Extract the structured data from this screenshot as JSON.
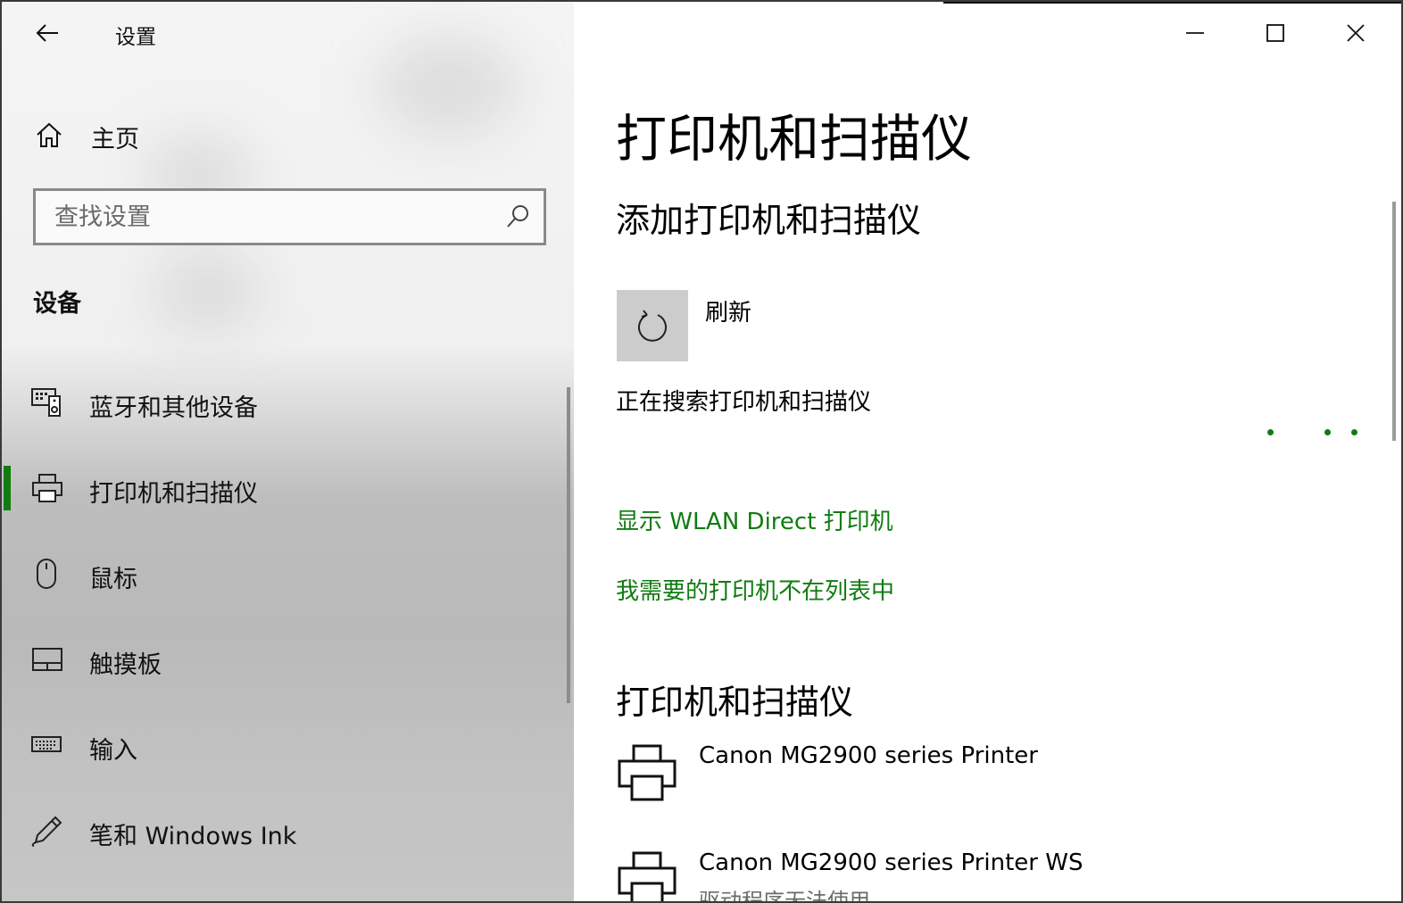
{
  "window": {
    "app_title": "设置",
    "controls": {
      "minimize": "minimize",
      "maximize": "maximize",
      "close": "close"
    }
  },
  "sidebar": {
    "home_label": "主页",
    "search_placeholder": "查找设置",
    "section_label": "设备",
    "items": [
      {
        "label": "蓝牙和其他设备",
        "icon": "bluetooth-devices-icon",
        "active": false
      },
      {
        "label": "打印机和扫描仪",
        "icon": "printer-icon",
        "active": true
      },
      {
        "label": "鼠标",
        "icon": "mouse-icon",
        "active": false
      },
      {
        "label": "触摸板",
        "icon": "touchpad-icon",
        "active": false
      },
      {
        "label": "输入",
        "icon": "keyboard-icon",
        "active": false
      },
      {
        "label": "笔和 Windows Ink",
        "icon": "pen-icon",
        "active": false
      }
    ]
  },
  "main": {
    "page_title": "打印机和扫描仪",
    "add_section_title": "添加打印机和扫描仪",
    "refresh_label": "刷新",
    "searching_text": "正在搜索打印机和扫描仪",
    "links": {
      "wlan_direct": "显示 WLAN Direct 打印机",
      "not_listed": "我需要的打印机不在列表中"
    },
    "printers_section_title": "打印机和扫描仪",
    "printers": [
      {
        "name": "Canon MG2900 series Printer",
        "status": ""
      },
      {
        "name": "Canon MG2900 series Printer WS",
        "status": "驱动程序无法使用"
      }
    ]
  },
  "colors": {
    "accent": "#107c10",
    "refresh_tile": "#cccccc",
    "sidebar_light": "#f4f4f4",
    "sidebar_dark": "#bdbdbd"
  }
}
